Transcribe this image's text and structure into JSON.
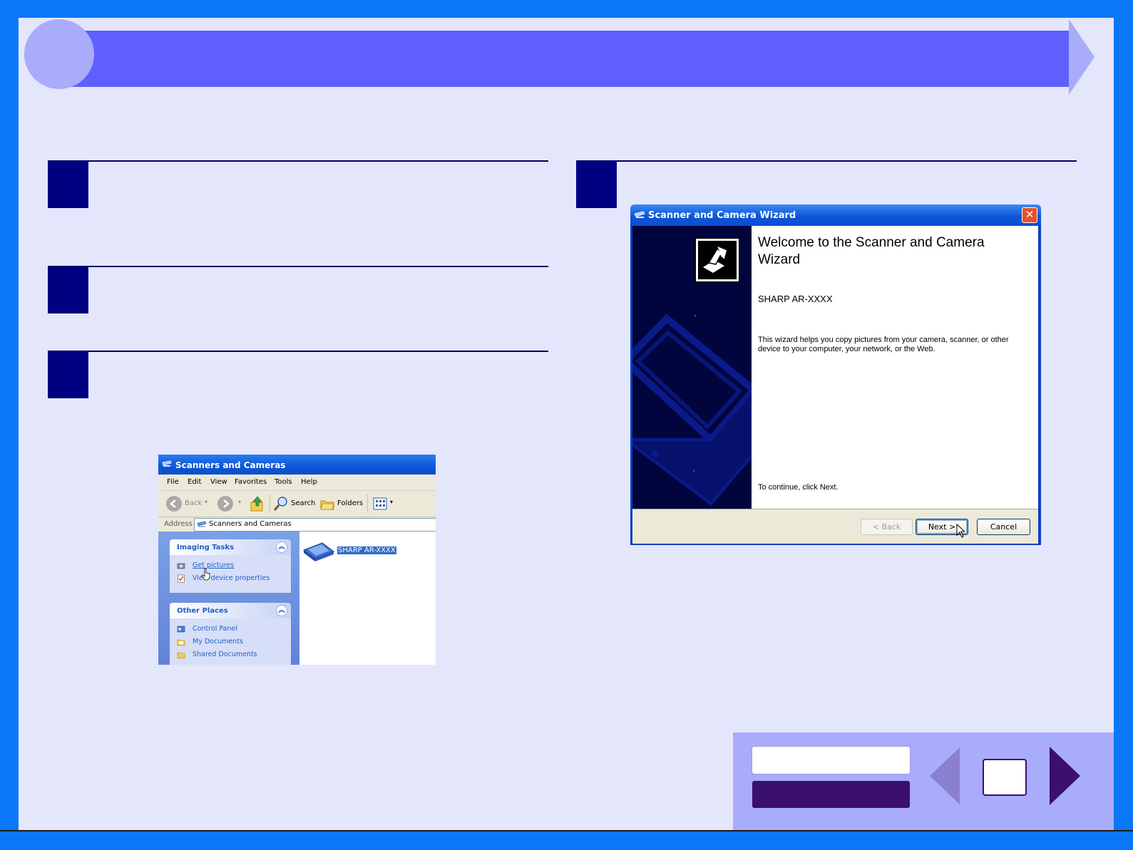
{
  "explorer": {
    "title": "Scanners and Cameras",
    "menu": [
      "File",
      "Edit",
      "View",
      "Favorites",
      "Tools",
      "Help"
    ],
    "toolbar": {
      "back": "Back",
      "search": "Search",
      "folders": "Folders"
    },
    "address_label": "Address",
    "address_value": "Scanners and Cameras",
    "imaging_tasks": {
      "title": "Imaging Tasks",
      "items": [
        "Get pictures",
        "View device properties"
      ]
    },
    "other_places": {
      "title": "Other Places",
      "items": [
        "Control Panel",
        "My Documents",
        "Shared Documents"
      ]
    },
    "device_label": "SHARP AR-XXXX"
  },
  "wizard": {
    "title": "Scanner and Camera Wizard",
    "close": "✕",
    "heading": "Welcome to the Scanner and Camera Wizard",
    "device": "SHARP AR-XXXX",
    "description": "This wizard helps you copy pictures from your camera, scanner, or other device to your computer, your network, or the Web.",
    "continue_text": "To continue, click Next.",
    "buttons": {
      "back": "< Back",
      "next": "Next >",
      "cancel": "Cancel"
    }
  },
  "colors": {
    "frame": "#0a78f6",
    "page": "#e4e6fb",
    "title_bar": "#5f5ffe",
    "step_box": "#000080",
    "nav_purple": "#3a0f6e"
  }
}
